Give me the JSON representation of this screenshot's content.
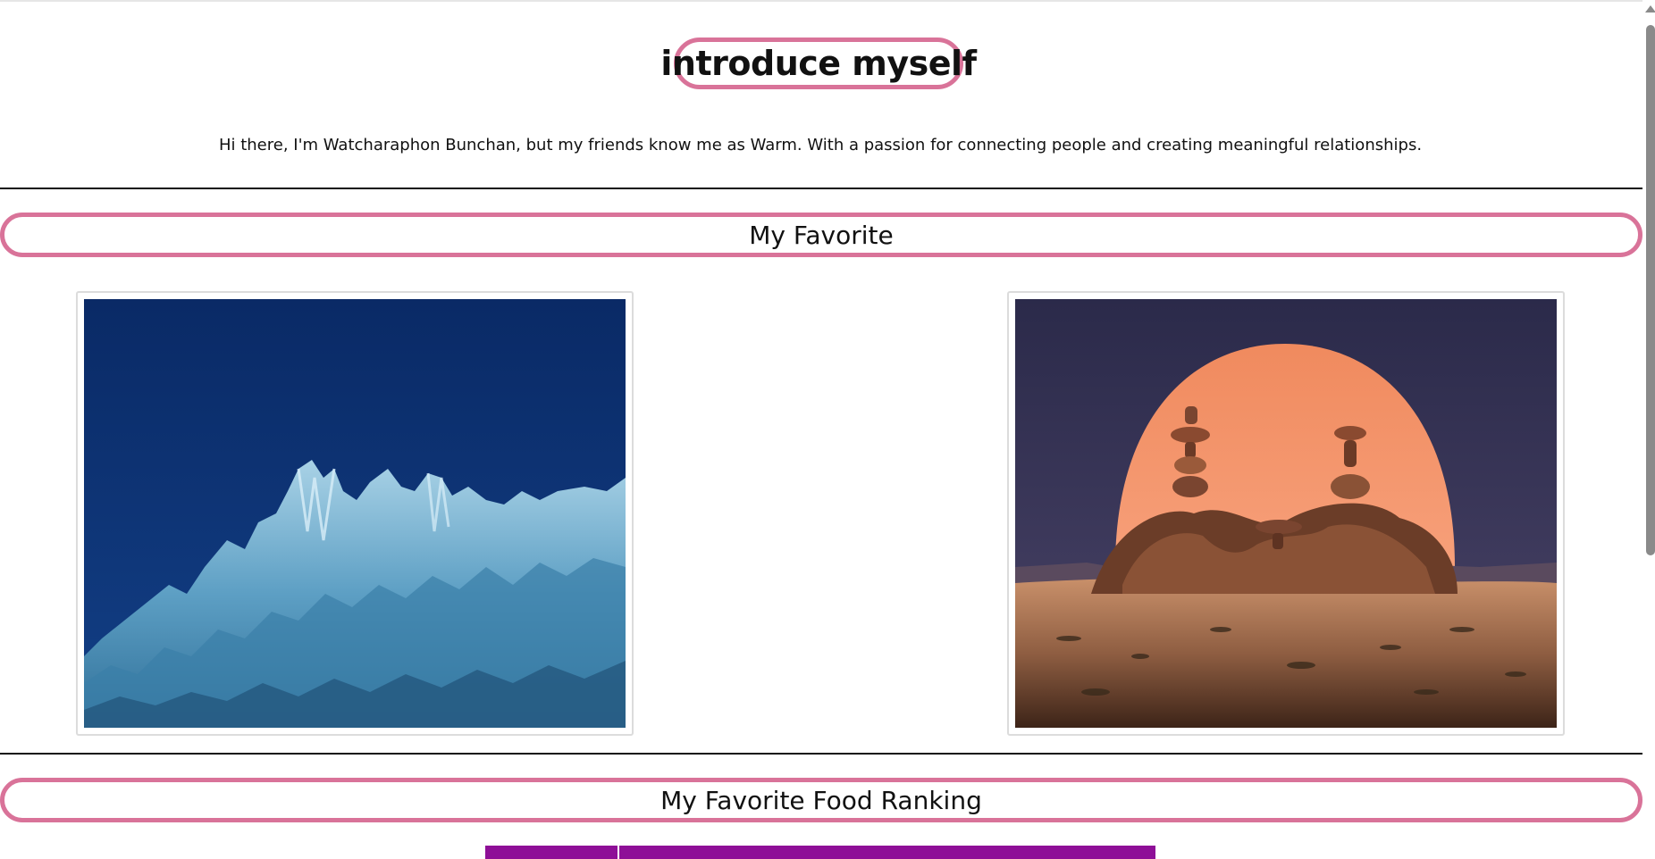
{
  "header": {
    "title": "introduce myself",
    "intro": "Hi there, I'm Watcharaphon Bunchan, but my friends know me as Warm. With a passion for connecting people and creating meaningful relationships."
  },
  "sections": {
    "favorite": {
      "title": "My Favorite",
      "photos": [
        {
          "subject": "blue-tinted rocky mountain ridge under deep blue sky"
        },
        {
          "subject": "stacked desert rocks in front of a large orange sun at dusk"
        }
      ]
    },
    "food_ranking": {
      "title": "My Favorite Food Ranking"
    }
  },
  "colors": {
    "accent_border": "#d97399",
    "divider": "#111111",
    "table_header": "#8e0f97"
  }
}
